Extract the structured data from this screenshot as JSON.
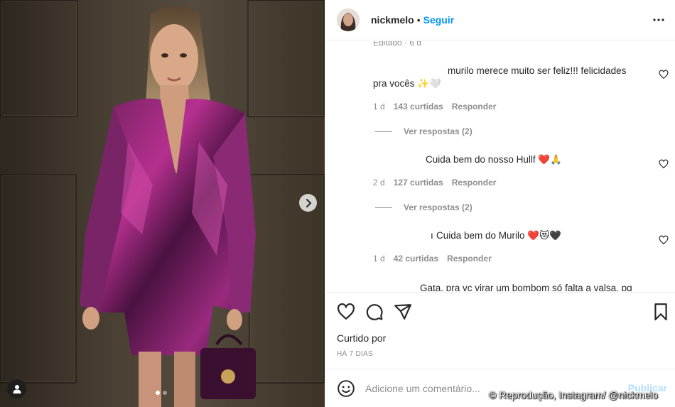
{
  "post": {
    "username": "nickmelo",
    "separator": "•",
    "follow_label": "Seguir",
    "carousel": {
      "total": 2,
      "active": 1
    }
  },
  "comments": {
    "top_meta": "Editado · 6 d",
    "items": [
      {
        "text_line1": "murilo merece muito ser feliz!!! felicidades",
        "text_line2": "pra vocês ✨🤍",
        "age": "1 d",
        "likes": "143 curtidas",
        "reply": "Responder",
        "view_replies": "Ver respostas (2)"
      },
      {
        "text_line1": "Cuida bem do nosso Hullf ❤️🙏",
        "age": "2 d",
        "likes": "127 curtidas",
        "reply": "Responder",
        "view_replies": "Ver respostas (2)"
      },
      {
        "prefix": "ı",
        "text_line1": "Cuida bem do Murilo ❤️😻🖤",
        "age": "1 d",
        "likes": "42 curtidas",
        "reply": "Responder"
      },
      {
        "text_line1": "Gata, pra vc virar um bombom só falta a valsa. pq"
      }
    ]
  },
  "actions": {
    "liked_by": "Curtido por",
    "posted": "HÁ 7 DIAS"
  },
  "composer": {
    "placeholder": "Adicione um comentário...",
    "publish_label": "Publicar"
  },
  "watermark": "© Reprodução, Instagram/ @nickmelo",
  "icons": [
    "more-options-icon",
    "heart-icon",
    "comment-icon",
    "share-icon",
    "bookmark-icon",
    "emoji-icon",
    "chevron-right-icon",
    "user-tag-icon"
  ]
}
